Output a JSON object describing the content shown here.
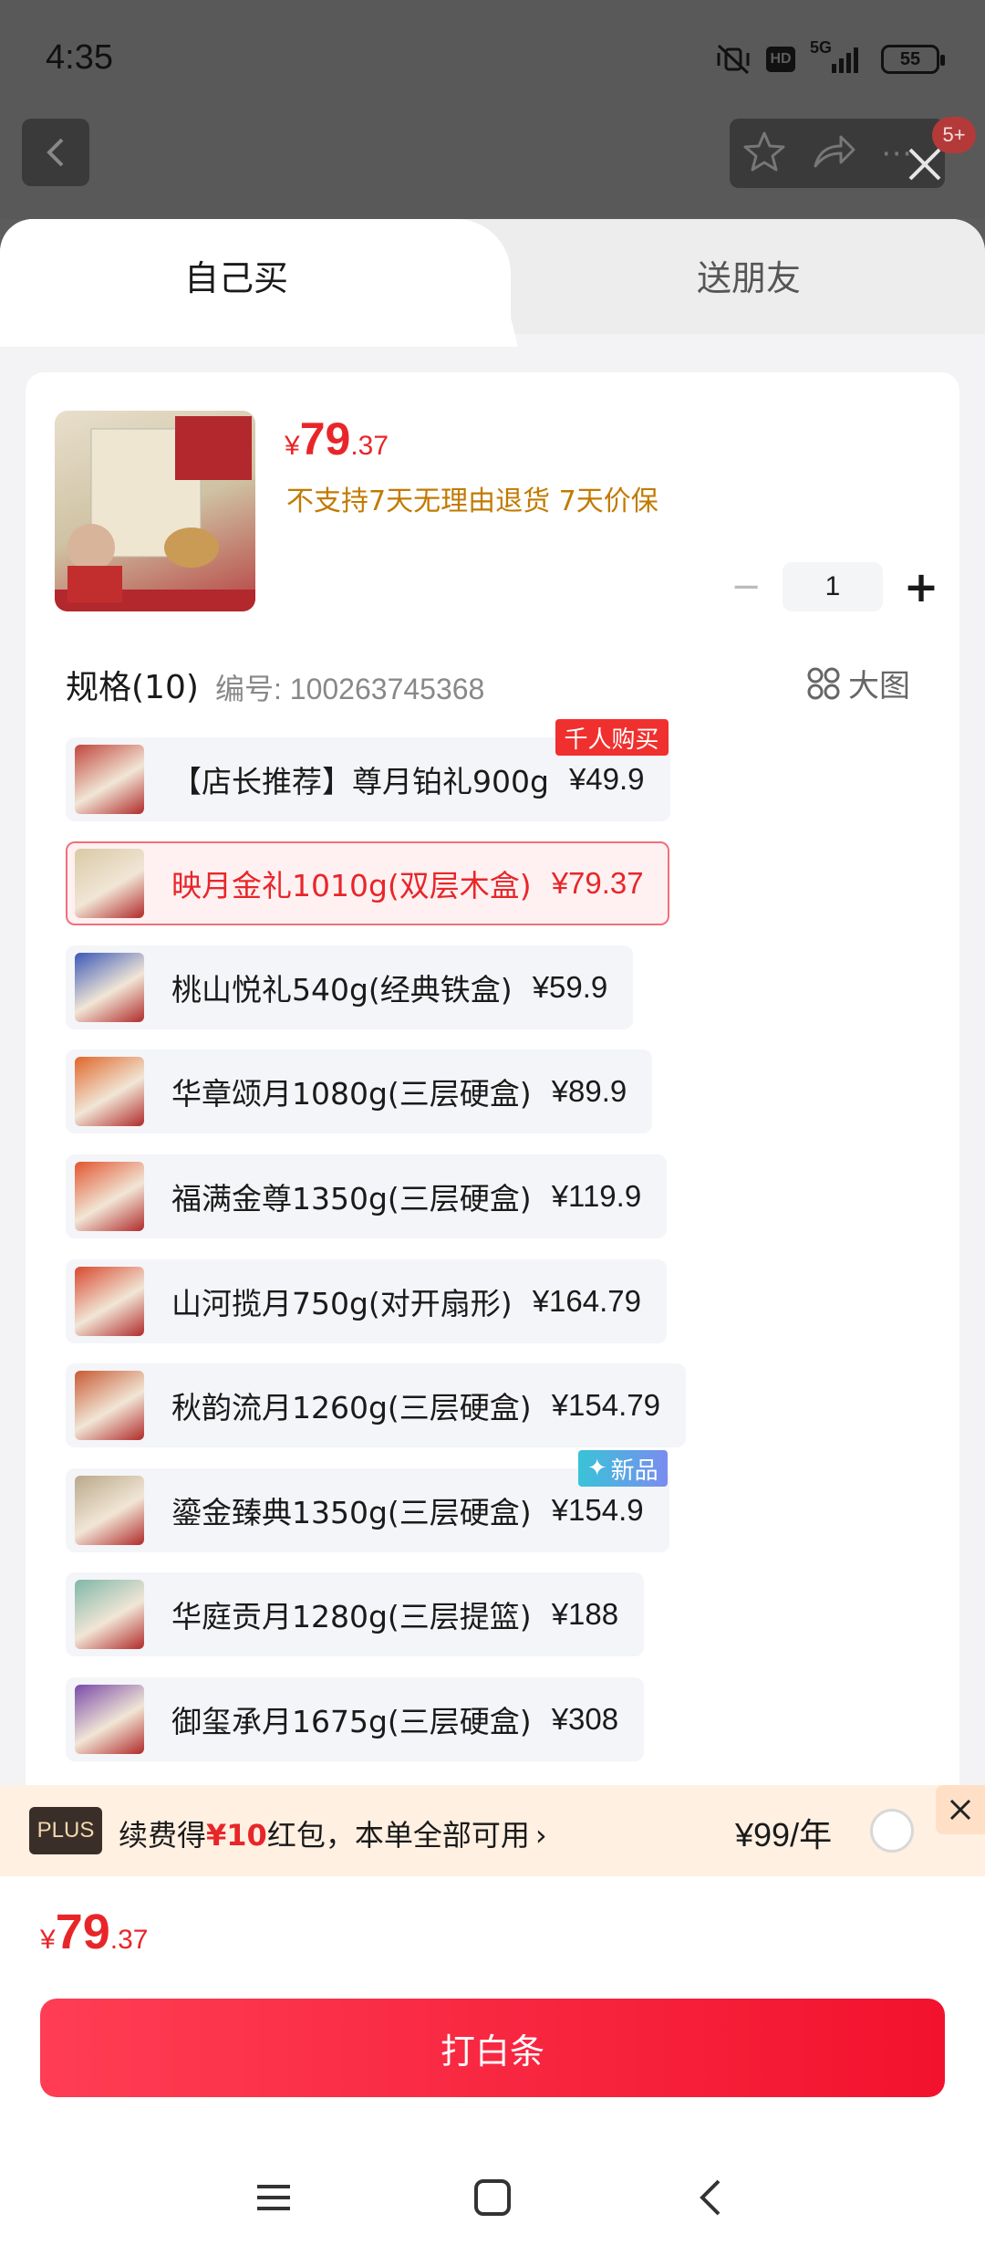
{
  "status_bar": {
    "time": "4:35",
    "signal_label": "5G",
    "hd_label": "HD",
    "battery": "55"
  },
  "top_bar": {
    "message_badge": "5+"
  },
  "tabs": [
    {
      "label": "自己买",
      "active": true
    },
    {
      "label": "送朋友",
      "active": false
    }
  ],
  "product": {
    "price_yen": "¥",
    "price_int": "79",
    "price_dec": ".37",
    "service": "不支持7天无理由退货  7天价保",
    "quantity": "1"
  },
  "specs": {
    "heading": "规格(10)",
    "code": "编号: 100263745368",
    "big_picture_label": "大图",
    "options": [
      {
        "label": "【店长推荐】尊月铂礼900g",
        "price": "¥49.9",
        "tag": "千人购买",
        "tag_type": "hot",
        "selected": false,
        "thumb_color": "#c0463c"
      },
      {
        "label": "映月金礼1010g(双层木盒)",
        "price": "¥79.37",
        "tag": "",
        "tag_type": "",
        "selected": true,
        "thumb_color": "#d9c9a5"
      },
      {
        "label": "桃山悦礼540g(经典铁盒)",
        "price": "¥59.9",
        "tag": "",
        "tag_type": "",
        "selected": false,
        "thumb_color": "#3b58b8"
      },
      {
        "label": "华章颂月1080g(三层硬盒)",
        "price": "¥89.9",
        "tag": "",
        "tag_type": "",
        "selected": false,
        "thumb_color": "#e0662a"
      },
      {
        "label": "福满金尊1350g(三层硬盒)",
        "price": "¥119.9",
        "tag": "",
        "tag_type": "",
        "selected": false,
        "thumb_color": "#e2552f"
      },
      {
        "label": "山河揽月750g(对开扇形)",
        "price": "¥164.79",
        "tag": "",
        "tag_type": "",
        "selected": false,
        "thumb_color": "#d8492f"
      },
      {
        "label": "秋韵流月1260g(三层硬盒)",
        "price": "¥154.79",
        "tag": "",
        "tag_type": "",
        "selected": false,
        "thumb_color": "#c85a33"
      },
      {
        "label": "鎏金臻典1350g(三层硬盒)",
        "price": "¥154.9",
        "tag": "新品",
        "tag_type": "new",
        "selected": false,
        "thumb_color": "#b9a88a"
      },
      {
        "label": "华庭贡月1280g(三层提篮)",
        "price": "¥188",
        "tag": "",
        "tag_type": "",
        "selected": false,
        "thumb_color": "#7fb7a8"
      },
      {
        "label": "御玺承月1675g(三层硬盒)",
        "price": "¥308",
        "tag": "",
        "tag_type": "",
        "selected": false,
        "thumb_color": "#7a4aa8"
      }
    ]
  },
  "plus_bar": {
    "logo": "PLUS",
    "text_pre": "续费得",
    "text_red": "¥10",
    "text_post": "红包，本单全部可用",
    "chevron": "›",
    "price": "¥99/年"
  },
  "bottom": {
    "price_yen": "¥",
    "price_int": "79",
    "price_dec": ".37",
    "cta_label": "打白条"
  },
  "colors": {
    "accent_red": "#e8262a",
    "service_orange": "#c27a00",
    "plus_bg": "#fff0e2"
  }
}
